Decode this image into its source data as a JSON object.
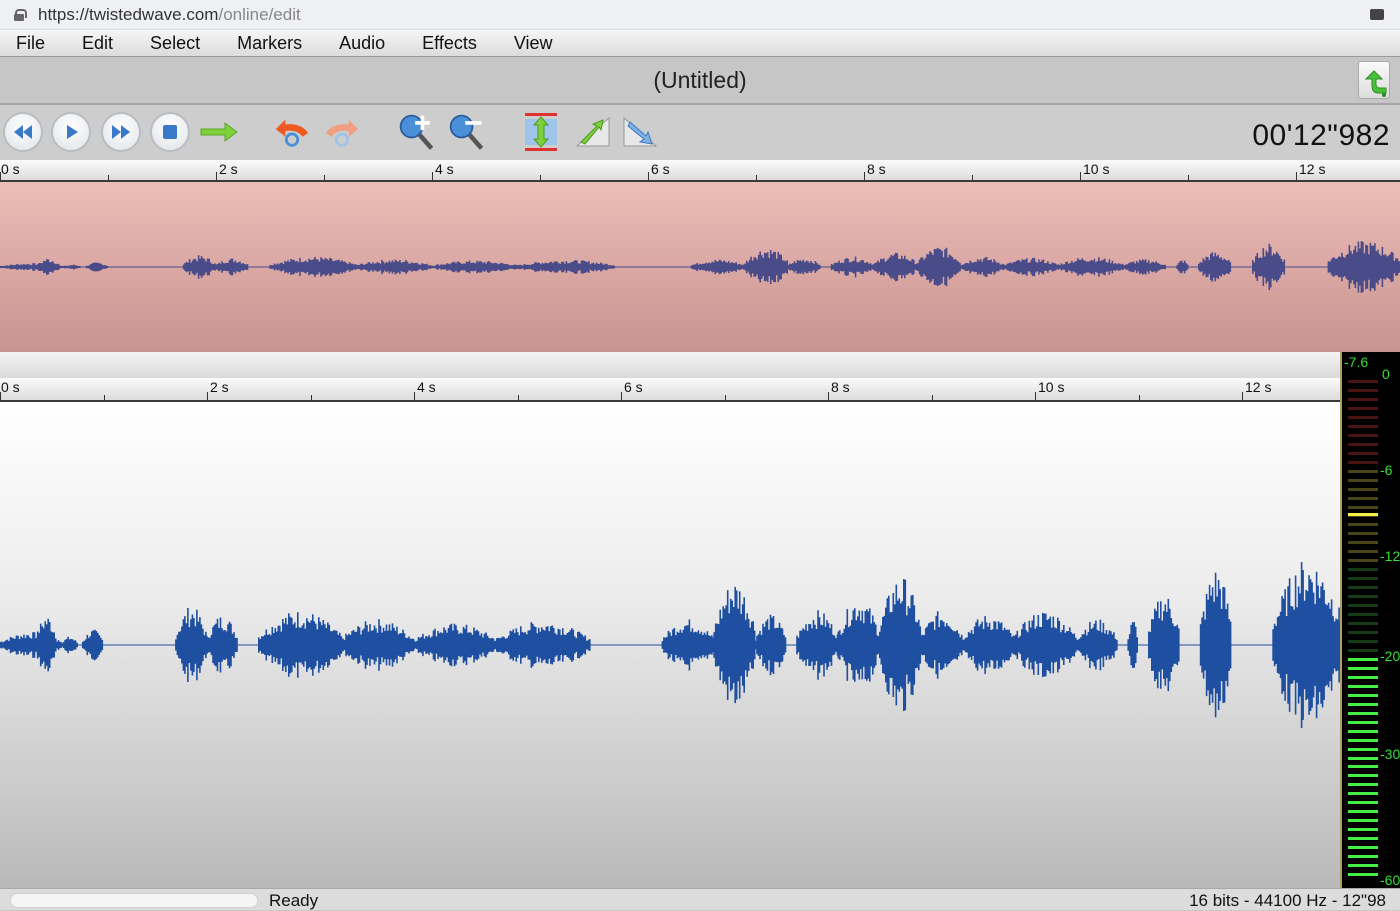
{
  "browser": {
    "url_host": "https://twistedwave.com",
    "url_path": "/online/edit"
  },
  "menu": [
    "File",
    "Edit",
    "Select",
    "Markers",
    "Audio",
    "Effects",
    "View"
  ],
  "document": {
    "title": "(Untitled)"
  },
  "toolbar": {
    "buttons": [
      {
        "name": "rewind",
        "icon": "rewind-icon"
      },
      {
        "name": "play",
        "icon": "play-icon"
      },
      {
        "name": "fast-forward",
        "icon": "fast-forward-icon"
      },
      {
        "name": "stop",
        "icon": "stop-icon"
      },
      {
        "name": "go-to",
        "icon": "arrow-right-icon"
      },
      {
        "name": "undo",
        "icon": "undo-icon"
      },
      {
        "name": "redo",
        "icon": "redo-icon"
      },
      {
        "name": "zoom-in",
        "icon": "zoom-in-icon"
      },
      {
        "name": "zoom-out",
        "icon": "zoom-out-icon"
      },
      {
        "name": "zoom-vertical",
        "icon": "vertical-zoom-icon"
      },
      {
        "name": "fade-in",
        "icon": "fade-in-icon"
      },
      {
        "name": "fade-out",
        "icon": "fade-out-icon"
      }
    ],
    "time_counter": "00'12\"982"
  },
  "overview_ruler": {
    "labels": [
      "0 s",
      "2 s",
      "4 s",
      "6 s",
      "8 s",
      "10 s",
      "12 s"
    ]
  },
  "main_ruler": {
    "labels": [
      "0 s",
      "2 s",
      "4 s",
      "6 s",
      "8 s",
      "10 s",
      "12 s"
    ]
  },
  "level_meter": {
    "peak_label": "-7.6",
    "scale": [
      "0",
      "-6",
      "-12",
      "-20",
      "-30",
      "-60"
    ],
    "level_db": -20,
    "peak_hold_db": -7.6
  },
  "colors": {
    "waveform": "#1f4fa0",
    "overview_waveform": "#4a4c8a",
    "meter_green": "#44ee44",
    "meter_yellow": "#f2f24a"
  },
  "status": {
    "progress": 0,
    "text": "Ready",
    "info": "16 bits - 44100 Hz - 12\"98"
  }
}
